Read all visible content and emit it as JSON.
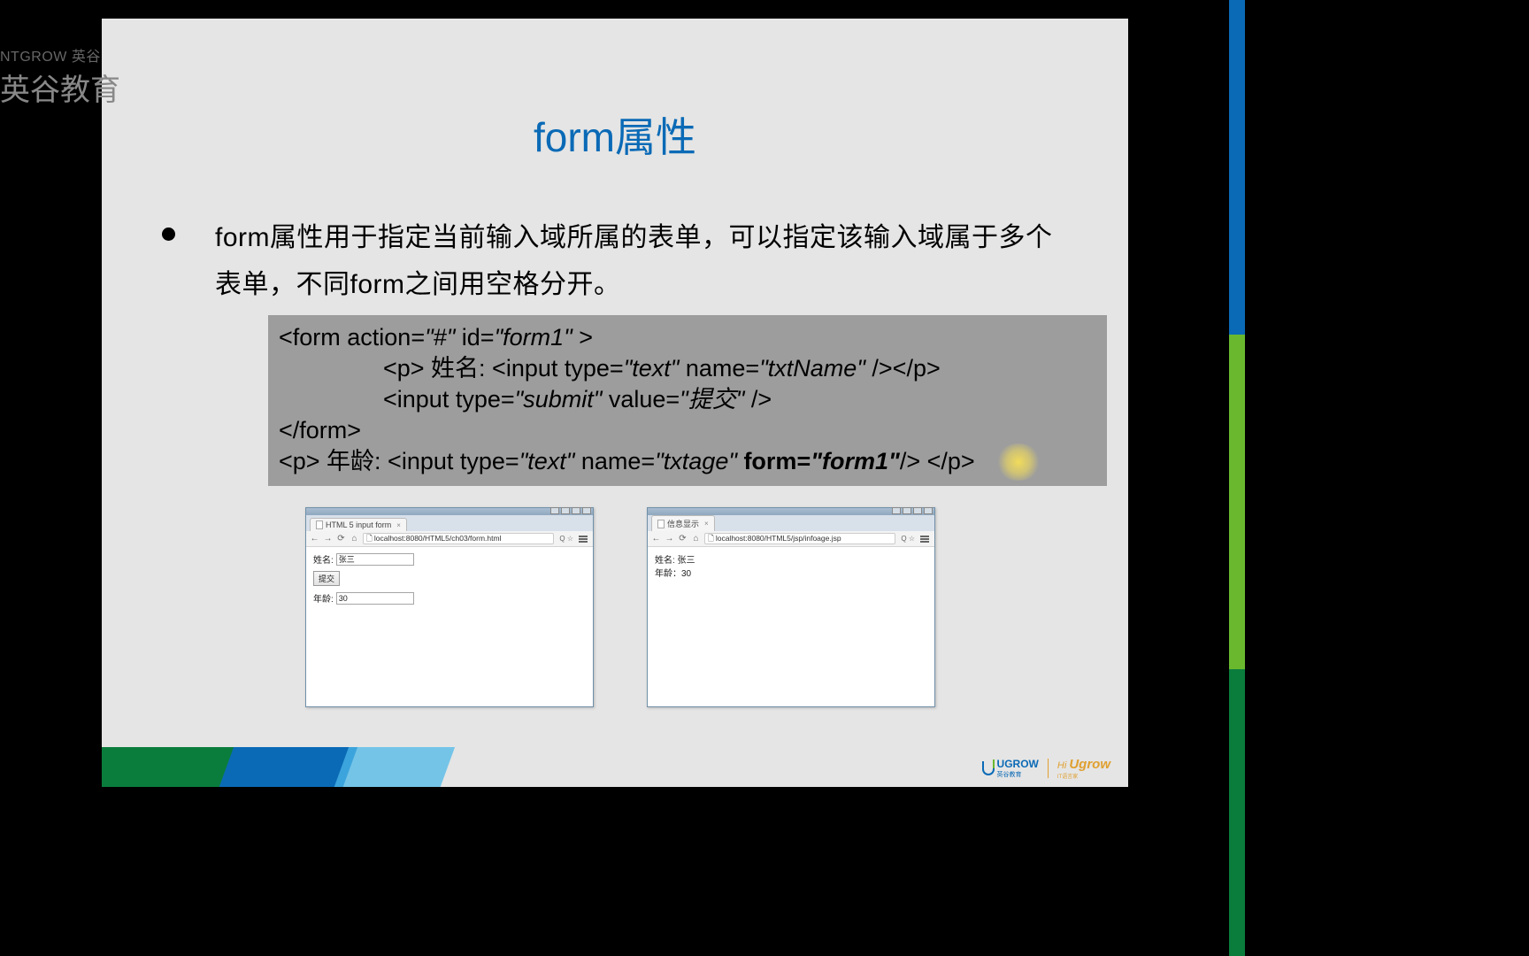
{
  "watermark": {
    "top": "NTGROW 英谷",
    "main": "英谷教育"
  },
  "slide": {
    "title": "form属性",
    "bullet_text": "form属性用于指定当前输入域所属的表单，可以指定该输入域属于多个表单，不同form之间用空格分开。",
    "code": {
      "line1_a": "<form action=",
      "line1_b": "\"#\"",
      "line1_c": " id=",
      "line1_d": "\"form1\"",
      "line1_e": " >",
      "line2_a": "<p>        姓名: <input type=",
      "line2_b": "\"text\"",
      "line2_c": " name=",
      "line2_d": "\"txtName\"",
      "line2_e": " /></p>",
      "line3_a": "<input type=",
      "line3_b": "\"submit\"",
      "line3_c": " value=",
      "line3_d": "\"提交\"",
      "line3_e": " />",
      "line4": "</form>",
      "line5_a": "<p>       年龄: <input type=",
      "line5_b": "\"text\"",
      "line5_c": " name=",
      "line5_d": "\"txtage\"",
      "line5_e": " form=",
      "line5_f": "\"form1\"",
      "line5_g": "/> </p>"
    }
  },
  "browser1": {
    "tab_title": "HTML 5 input form",
    "url": "localhost:8080/HTML5/ch03/form.html",
    "url_extra": "Q ☆",
    "form": {
      "name_label": "姓名:",
      "name_value": "张三",
      "submit_label": "提交",
      "age_label": "年龄:",
      "age_value": "30"
    }
  },
  "browser2": {
    "tab_title": "信息显示",
    "url": "localhost:8080/HTML5/jsp/infoage.jsp",
    "url_extra": "Q ☆",
    "result": {
      "name_line": "姓名: 张三",
      "age_line": "年龄：30"
    }
  },
  "footer": {
    "logo1_text": "UGROW",
    "logo1_sub": "英谷教育",
    "logo2_hi": "Hi ",
    "logo2_grow": "Ugrow",
    "logo2_sub": "IT语言家"
  }
}
